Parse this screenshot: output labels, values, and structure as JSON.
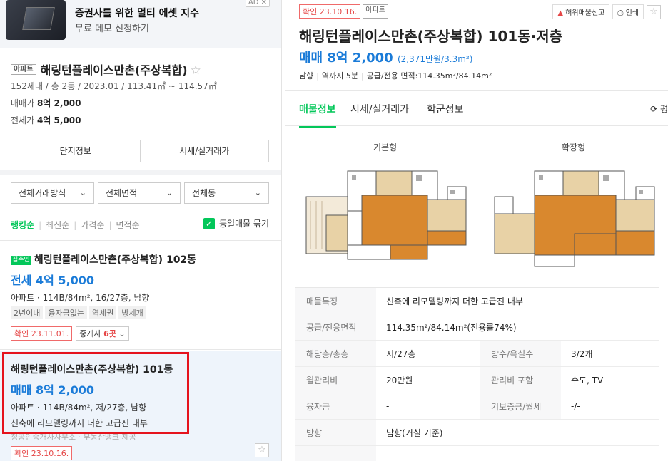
{
  "ad": {
    "title": "증권사를 위한 멀티 에셋 지수",
    "subtitle": "무료 데모 신청하기",
    "badge": "AD ✕"
  },
  "complex": {
    "type_tag": "아파트",
    "name": "해링턴플레이스만촌(주상복합)",
    "star": "☆",
    "meta": "152세대 / 총 2동 / 2023.01 / 113.41㎡ ~ 114.57㎡",
    "sale_label": "매매가",
    "sale_value": "8억 2,000",
    "jeonse_label": "전세가",
    "jeonse_value": "4억 5,000",
    "btn_info": "단지정보",
    "btn_price": "시세/실거래가"
  },
  "filters": [
    {
      "label": "전체거래방식",
      "chev": "⌄"
    },
    {
      "label": "전체면적",
      "chev": "⌄"
    },
    {
      "label": "전체동",
      "chev": "⌄"
    }
  ],
  "sort": {
    "items": [
      "랭킹순",
      "최신순",
      "가격순",
      "면적순"
    ],
    "group_label": "동일매물 묶기",
    "check": "✓"
  },
  "listings": [
    {
      "badge": "집주인",
      "title": "해링턴플레이스만촌(주상복합) 102동",
      "price": "전세 4억 5,000",
      "spec": "아파트 · 114B/84m², 16/27층, 남향",
      "tags": [
        "2년이내",
        "융자금없는",
        "역세권",
        "방세개"
      ],
      "confirm": "확인 23.11.01.",
      "agent_prefix": "중개사 ",
      "agent_count": "6곳",
      "agent_chev": " ⌄"
    },
    {
      "title": "해링턴플레이스만촌(주상복합) 101동",
      "price": "매매 8억 2,000",
      "spec": "아파트 · 114B/84m², 저/27층, 남향",
      "desc": "신축에 리모델링까지 더한 고급진 내부",
      "faded": "정공인중개사사무소 · 부동산뱅크 제공",
      "confirm": "확인 23.10.16.",
      "fav": "☆"
    }
  ],
  "detail": {
    "confirm": "확인 23.10.16.",
    "type_tag": "아파트",
    "report": "허위매물신고",
    "print": "인쇄",
    "fav": "☆",
    "title": "해링턴플레이스만촌(주상복합) 101동·저층",
    "price": "매매 8억 2,000",
    "price_per": "(2,371만원/3.3m²)",
    "summary": [
      "남향",
      "역까지 5분",
      "공급/전용 면적:114.35m²/84.14m²"
    ],
    "tabs": [
      "매물정보",
      "시세/실거래가",
      "학군정보"
    ],
    "refresh": "⟳ 평",
    "floorplan_basic": "기본형",
    "floorplan_ext": "확장형",
    "info": {
      "feature_k": "매물특징",
      "feature_v": "신축에 리모델링까지 더한 고급진 내부",
      "area_k": "공급/전용면적",
      "area_v": "114.35m²/84.14m²(전용률74%)",
      "floor_k": "해당층/총층",
      "floor_v": "저/27층",
      "rooms_k": "방수/욕실수",
      "rooms_v": "3/2개",
      "mgmt_k": "월관리비",
      "mgmt_v": "20만원",
      "mgmt_inc_k": "관리비 포함",
      "mgmt_inc_v": "수도, TV",
      "loan_k": "융자금",
      "loan_v": "-",
      "deposit_k": "기보증금/월세",
      "deposit_v": "-/-",
      "dir_k": "방향",
      "dir_v": "남향(거실 기준)"
    }
  },
  "colors": {
    "accent_green": "#03c75a",
    "price_blue": "#1a7bd8",
    "confirm_red": "#e54545",
    "highlight": "#e5131d"
  }
}
